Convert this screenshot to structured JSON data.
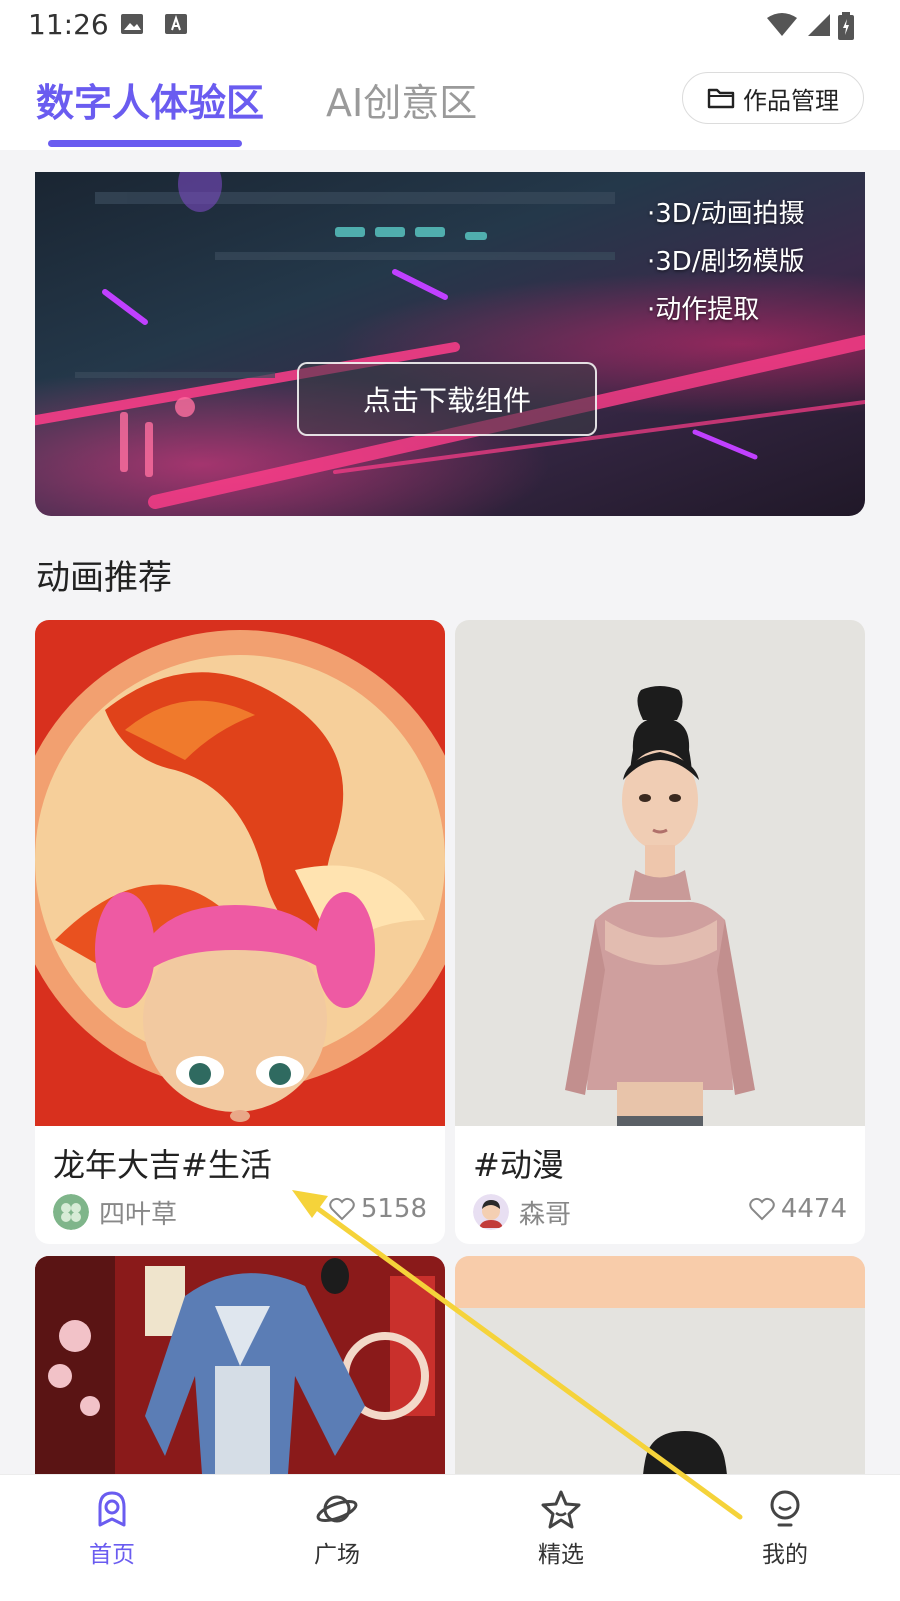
{
  "status_bar": {
    "time": "11:26"
  },
  "header": {
    "tabs": [
      {
        "label": "数字人体验区",
        "active": true
      },
      {
        "label": "AI创意区",
        "active": false
      }
    ],
    "works_button": "作品管理"
  },
  "banner": {
    "features": [
      "·3D/动画拍摄",
      "·3D/剧场模版",
      "·动作提取"
    ],
    "download_button": "点击下载组件"
  },
  "section": {
    "title": "动画推荐"
  },
  "cards": [
    {
      "title": "龙年大吉#生活",
      "author": "四叶草",
      "likes": "5158"
    },
    {
      "title": "#动漫",
      "author": "森哥",
      "likes": "4474"
    }
  ],
  "bottom_nav": [
    {
      "label": "首页",
      "icon": "home-icon",
      "active": true
    },
    {
      "label": "广场",
      "icon": "planet-icon",
      "active": false
    },
    {
      "label": "精选",
      "icon": "star-icon",
      "active": false
    },
    {
      "label": "我的",
      "icon": "profile-icon",
      "active": false
    }
  ],
  "colors": {
    "accent": "#6a5cf0",
    "annotation_arrow": "#f5d33a"
  }
}
